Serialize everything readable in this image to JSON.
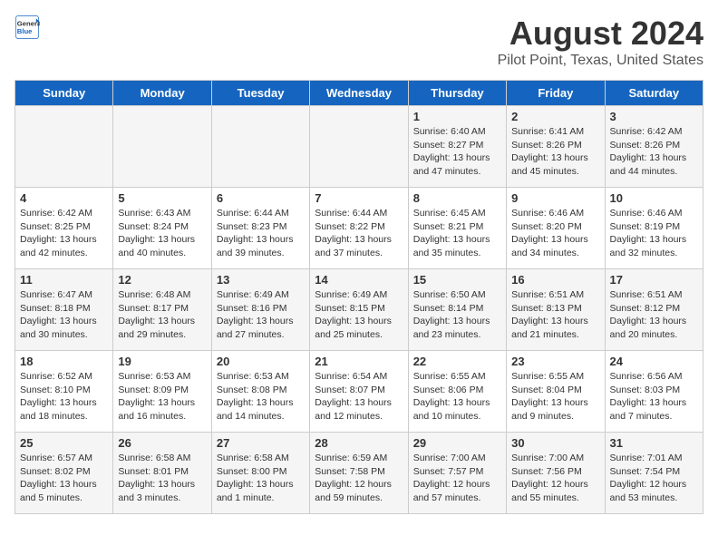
{
  "header": {
    "logo_general": "General",
    "logo_blue": "Blue",
    "title": "August 2024",
    "subtitle": "Pilot Point, Texas, United States"
  },
  "weekdays": [
    "Sunday",
    "Monday",
    "Tuesday",
    "Wednesday",
    "Thursday",
    "Friday",
    "Saturday"
  ],
  "weeks": [
    [
      {
        "day": "",
        "content": ""
      },
      {
        "day": "",
        "content": ""
      },
      {
        "day": "",
        "content": ""
      },
      {
        "day": "",
        "content": ""
      },
      {
        "day": "1",
        "content": "Sunrise: 6:40 AM\nSunset: 8:27 PM\nDaylight: 13 hours and 47 minutes."
      },
      {
        "day": "2",
        "content": "Sunrise: 6:41 AM\nSunset: 8:26 PM\nDaylight: 13 hours and 45 minutes."
      },
      {
        "day": "3",
        "content": "Sunrise: 6:42 AM\nSunset: 8:26 PM\nDaylight: 13 hours and 44 minutes."
      }
    ],
    [
      {
        "day": "4",
        "content": "Sunrise: 6:42 AM\nSunset: 8:25 PM\nDaylight: 13 hours and 42 minutes."
      },
      {
        "day": "5",
        "content": "Sunrise: 6:43 AM\nSunset: 8:24 PM\nDaylight: 13 hours and 40 minutes."
      },
      {
        "day": "6",
        "content": "Sunrise: 6:44 AM\nSunset: 8:23 PM\nDaylight: 13 hours and 39 minutes."
      },
      {
        "day": "7",
        "content": "Sunrise: 6:44 AM\nSunset: 8:22 PM\nDaylight: 13 hours and 37 minutes."
      },
      {
        "day": "8",
        "content": "Sunrise: 6:45 AM\nSunset: 8:21 PM\nDaylight: 13 hours and 35 minutes."
      },
      {
        "day": "9",
        "content": "Sunrise: 6:46 AM\nSunset: 8:20 PM\nDaylight: 13 hours and 34 minutes."
      },
      {
        "day": "10",
        "content": "Sunrise: 6:46 AM\nSunset: 8:19 PM\nDaylight: 13 hours and 32 minutes."
      }
    ],
    [
      {
        "day": "11",
        "content": "Sunrise: 6:47 AM\nSunset: 8:18 PM\nDaylight: 13 hours and 30 minutes."
      },
      {
        "day": "12",
        "content": "Sunrise: 6:48 AM\nSunset: 8:17 PM\nDaylight: 13 hours and 29 minutes."
      },
      {
        "day": "13",
        "content": "Sunrise: 6:49 AM\nSunset: 8:16 PM\nDaylight: 13 hours and 27 minutes."
      },
      {
        "day": "14",
        "content": "Sunrise: 6:49 AM\nSunset: 8:15 PM\nDaylight: 13 hours and 25 minutes."
      },
      {
        "day": "15",
        "content": "Sunrise: 6:50 AM\nSunset: 8:14 PM\nDaylight: 13 hours and 23 minutes."
      },
      {
        "day": "16",
        "content": "Sunrise: 6:51 AM\nSunset: 8:13 PM\nDaylight: 13 hours and 21 minutes."
      },
      {
        "day": "17",
        "content": "Sunrise: 6:51 AM\nSunset: 8:12 PM\nDaylight: 13 hours and 20 minutes."
      }
    ],
    [
      {
        "day": "18",
        "content": "Sunrise: 6:52 AM\nSunset: 8:10 PM\nDaylight: 13 hours and 18 minutes."
      },
      {
        "day": "19",
        "content": "Sunrise: 6:53 AM\nSunset: 8:09 PM\nDaylight: 13 hours and 16 minutes."
      },
      {
        "day": "20",
        "content": "Sunrise: 6:53 AM\nSunset: 8:08 PM\nDaylight: 13 hours and 14 minutes."
      },
      {
        "day": "21",
        "content": "Sunrise: 6:54 AM\nSunset: 8:07 PM\nDaylight: 13 hours and 12 minutes."
      },
      {
        "day": "22",
        "content": "Sunrise: 6:55 AM\nSunset: 8:06 PM\nDaylight: 13 hours and 10 minutes."
      },
      {
        "day": "23",
        "content": "Sunrise: 6:55 AM\nSunset: 8:04 PM\nDaylight: 13 hours and 9 minutes."
      },
      {
        "day": "24",
        "content": "Sunrise: 6:56 AM\nSunset: 8:03 PM\nDaylight: 13 hours and 7 minutes."
      }
    ],
    [
      {
        "day": "25",
        "content": "Sunrise: 6:57 AM\nSunset: 8:02 PM\nDaylight: 13 hours and 5 minutes."
      },
      {
        "day": "26",
        "content": "Sunrise: 6:58 AM\nSunset: 8:01 PM\nDaylight: 13 hours and 3 minutes."
      },
      {
        "day": "27",
        "content": "Sunrise: 6:58 AM\nSunset: 8:00 PM\nDaylight: 13 hours and 1 minute."
      },
      {
        "day": "28",
        "content": "Sunrise: 6:59 AM\nSunset: 7:58 PM\nDaylight: 12 hours and 59 minutes."
      },
      {
        "day": "29",
        "content": "Sunrise: 7:00 AM\nSunset: 7:57 PM\nDaylight: 12 hours and 57 minutes."
      },
      {
        "day": "30",
        "content": "Sunrise: 7:00 AM\nSunset: 7:56 PM\nDaylight: 12 hours and 55 minutes."
      },
      {
        "day": "31",
        "content": "Sunrise: 7:01 AM\nSunset: 7:54 PM\nDaylight: 12 hours and 53 minutes."
      }
    ]
  ]
}
